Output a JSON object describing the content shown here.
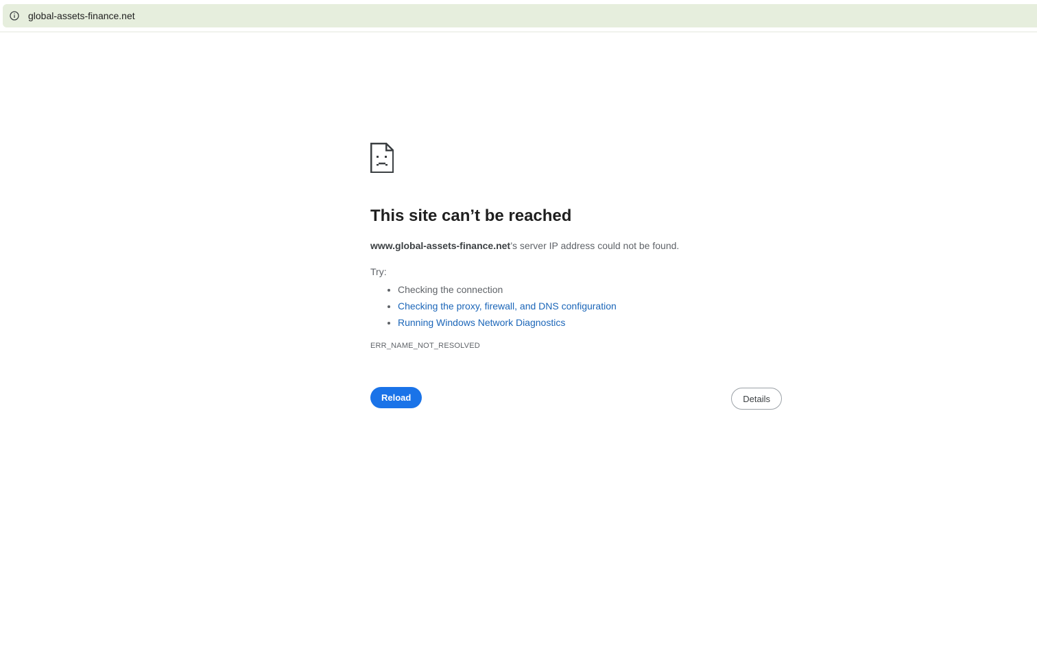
{
  "browser": {
    "url": "global-assets-finance.net",
    "info_icon": "info-circle-icon"
  },
  "error": {
    "icon": "sad-page-icon",
    "title": "This site can’t be reached",
    "host": "www.global-assets-finance.net",
    "message_suffix": "’s server IP address could not be found.",
    "try_label": "Try:",
    "suggestions": [
      "Checking the connection",
      "Checking the proxy, firewall, and DNS configuration",
      "Running Windows Network Diagnostics"
    ],
    "code": "ERR_NAME_NOT_RESOLVED"
  },
  "buttons": {
    "reload_label": "Reload",
    "details_label": "Details"
  },
  "colors": {
    "accent": "#1a73e8",
    "link": "#1a65b8",
    "omnibox_bg": "#e6eedd"
  }
}
